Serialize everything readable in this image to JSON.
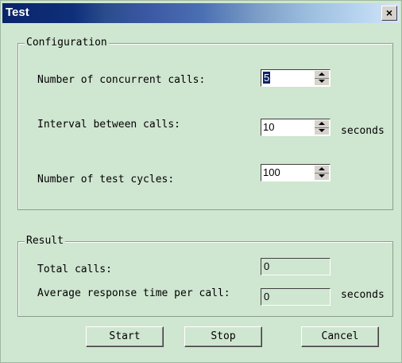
{
  "window": {
    "title": "Test",
    "close_label": "×"
  },
  "configuration": {
    "title": "Configuration",
    "concurrent_calls": {
      "label": "Number of concurrent calls:",
      "value": "5"
    },
    "interval": {
      "label": "Interval between calls:",
      "value": "10",
      "unit": "seconds"
    },
    "test_cycles": {
      "label": "Number of test cycles:",
      "value": "100"
    }
  },
  "result": {
    "title": "Result",
    "total_calls": {
      "label": "Total calls:",
      "value": "0"
    },
    "avg_response": {
      "label": "Average response time per call:",
      "value": "0",
      "unit": "seconds"
    }
  },
  "buttons": {
    "start": "Start",
    "stop": "Stop",
    "cancel": "Cancel"
  }
}
